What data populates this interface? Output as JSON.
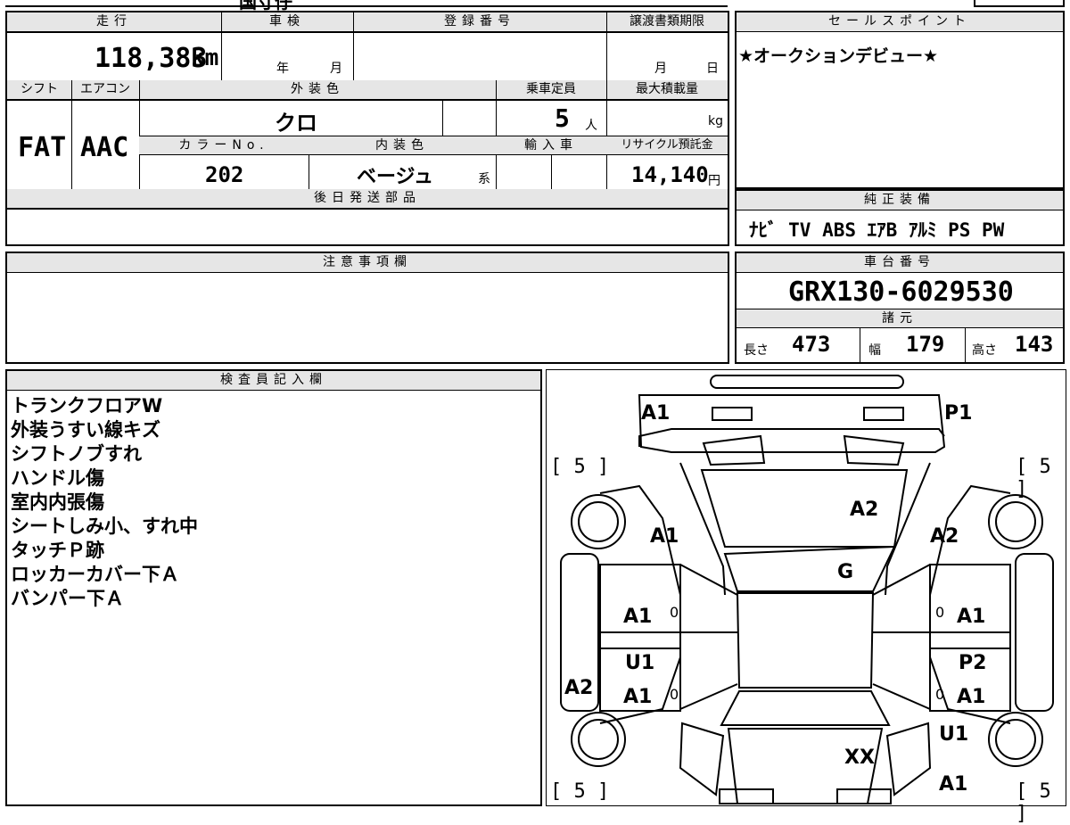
{
  "top_fragment": "国寸仔",
  "main_table": {
    "mileage_label": "走行",
    "inspection_label": "車検",
    "registration_label": "登録番号",
    "transfer_label": "譲渡書類期限",
    "mileage_value": "118,383",
    "mileage_unit": "km",
    "year_label": "年",
    "month_label": "月",
    "transfer_month": "月",
    "transfer_day": "日",
    "shift_label": "シフト",
    "ac_label": "エアコン",
    "exterior_color_label": "外装色",
    "capacity_label": "乗車定員",
    "max_load_label": "最大積載量",
    "shift_value": "FAT",
    "ac_value": "AAC",
    "exterior_color_value": "クロ",
    "capacity_value": "5",
    "capacity_unit": "人",
    "load_unit": "kg",
    "color_no_label": "カラーNo.",
    "interior_color_label": "内装色",
    "import_label": "輸入車",
    "recycle_label": "リサイクル預託金",
    "color_no_value": "202",
    "interior_color_value": "ベージュ",
    "interior_suffix": "系",
    "recycle_value": "14,140",
    "recycle_unit": "円",
    "later_parts_label": "後日発送部品"
  },
  "sales_point": {
    "label": "セールスポイント",
    "text": "★オークションデビュー★"
  },
  "genuine_equipment": {
    "label": "純正装備",
    "items": "ﾅﾋﾞ TV ABS ｴｱB ｱﾙﾐ PS PW"
  },
  "notes": {
    "label": "注意事項欄"
  },
  "chassis": {
    "label": "車台番号",
    "value": "GRX130-6029530",
    "spec_label": "諸元",
    "length_label": "長さ",
    "length_value": "473",
    "width_label": "幅",
    "width_value": "179",
    "height_label": "高さ",
    "height_value": "143"
  },
  "inspector": {
    "label": "検査員記入欄",
    "lines": [
      "トランクフロアW",
      "外装うすい線キズ",
      "シフトノブすれ",
      "ハンドル傷",
      "室内内張傷",
      "シートしみ小、すれ中",
      "タッチＰ跡",
      "ロッカーカバー下Ａ",
      "バンパー下Ａ"
    ]
  },
  "diagram": {
    "tire_tl": "5",
    "tire_tr": "5",
    "tire_bl": "5",
    "tire_br": "5",
    "marks": {
      "rear_left": "A1",
      "rear_right": "P1",
      "trunk": "A2",
      "left_rear_fender": "A1",
      "right_rear_fender": "A2",
      "rear_glass": "G",
      "left_rear_door": "A1",
      "left_front_door_u": "U1",
      "left_front_door": "A1",
      "left_rocker": "A2",
      "right_rear_door": "A1",
      "right_front_door_p": "P2",
      "right_front_door": "A1",
      "right_front_fender_u": "U1",
      "right_front_fender": "A1",
      "hood": "XX",
      "zero_1": "0",
      "zero_2": "0",
      "zero_3": "0",
      "zero_4": "0"
    }
  }
}
